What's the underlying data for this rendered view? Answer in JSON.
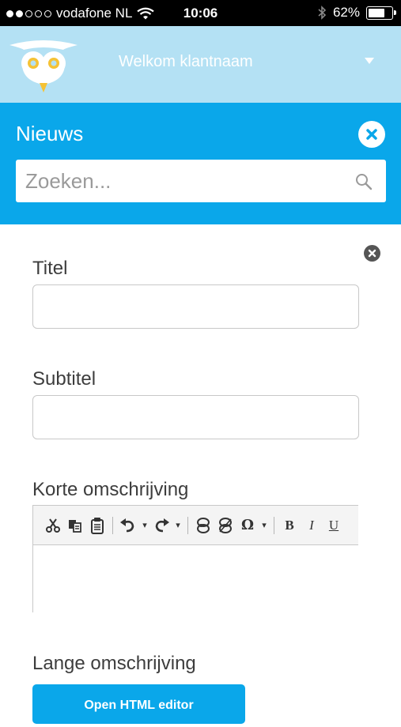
{
  "status_bar": {
    "carrier": "vodafone NL",
    "signal_bars": 2,
    "signal_total": 5,
    "time": "10:06",
    "battery_text": "62%",
    "battery_level": 0.62
  },
  "header": {
    "welcome": "Welkom klantnaam",
    "logo_icon": "owl-logo-icon",
    "menu_icon": "caret-down-icon"
  },
  "news": {
    "title": "Nieuws",
    "close_icon": "close-icon",
    "search": {
      "placeholder": "Zoeken...",
      "value": "",
      "icon": "search-icon"
    }
  },
  "form": {
    "close_icon": "close-icon",
    "titel_label": "Titel",
    "titel_value": "",
    "subtitel_label": "Subtitel",
    "subtitel_value": "",
    "korte_label": "Korte omschrijving",
    "toolbar": {
      "bold": "B",
      "italic": "I",
      "underline": "U",
      "omega": "Ω"
    },
    "lange_label": "Lange omschrijving",
    "html_button": "Open HTML editor"
  },
  "colors": {
    "header_bg": "#b4e1f4",
    "accent": "#0aa7ea"
  }
}
